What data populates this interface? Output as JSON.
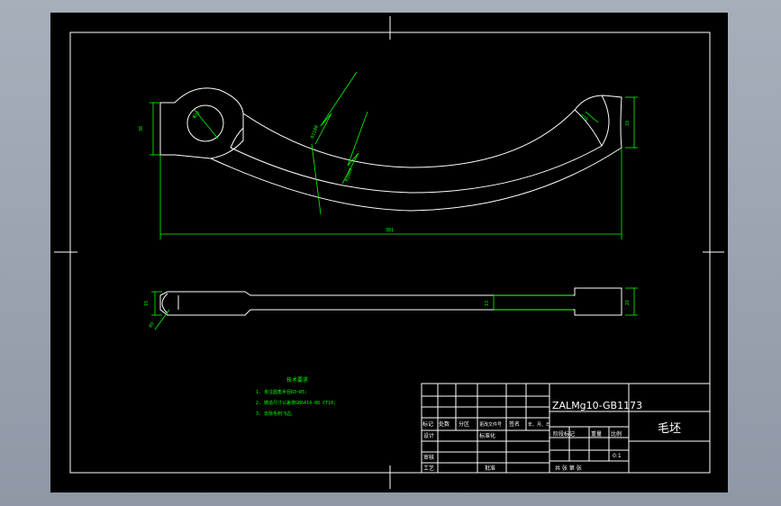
{
  "drawing": {
    "dimensions": {
      "top_left_height": "38",
      "hole_dia": "Φ20",
      "top_right_height": "33",
      "right_radius": "R16",
      "overall_length": "381",
      "radius_upper": "R1100",
      "radius_lower": "R1000",
      "side_left_height": "15",
      "side_mid_thickness": "13",
      "side_right_height": "21",
      "side_left_angle": "R5"
    },
    "notes": {
      "title": "技术要求",
      "items": [
        "1. 未注圆角半径R3~R5;",
        "2. 铸造尺寸公差按GB6414-86 CT10;",
        "3. 去除毛刺飞边。"
      ]
    },
    "title_block": {
      "material": "ZALMg10-GB1173",
      "part_name": "毛坯",
      "rev_headers": [
        "标记",
        "处数",
        "分区",
        "更改文件号",
        "签名",
        "年、月、日"
      ],
      "design_label": "设计",
      "standardize_label": "标准化",
      "review_label": "审核",
      "process_label": "工艺",
      "approve_label": "批准",
      "stage_label": "阶段标记",
      "weight_label": "重量",
      "scale_label": "比例",
      "scale_value": "0:1",
      "sheet_info": "共    张    第    张"
    }
  }
}
